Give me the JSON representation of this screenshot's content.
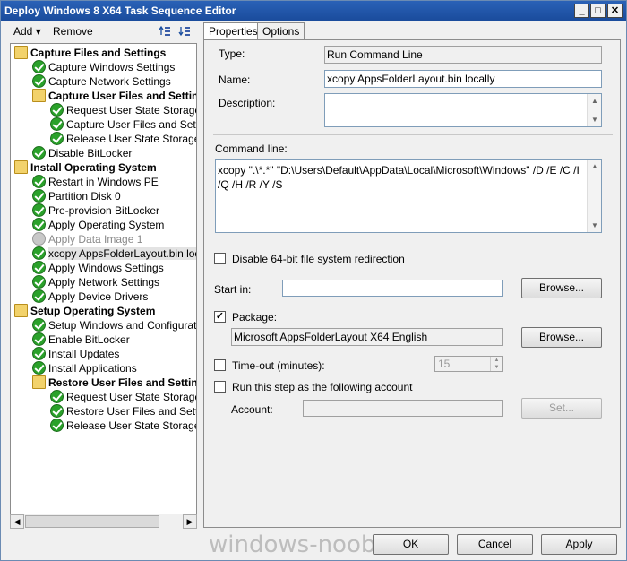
{
  "window": {
    "title": "Deploy Windows 8 X64 Task Sequence Editor",
    "minimize": "_",
    "maximize": "□",
    "close": "✕"
  },
  "toolbar": {
    "add": "Add",
    "add_arrow": "▾",
    "remove": "Remove"
  },
  "tree": [
    {
      "label": "Capture Files and Settings",
      "icon": "folder",
      "level": 0,
      "bold": true
    },
    {
      "label": "Capture Windows Settings",
      "icon": "check",
      "level": 1
    },
    {
      "label": "Capture Network Settings",
      "icon": "check",
      "level": 1
    },
    {
      "label": "Capture User Files and Settings",
      "icon": "folder",
      "level": 1,
      "bold": true
    },
    {
      "label": "Request User State Storage",
      "icon": "check",
      "level": 2
    },
    {
      "label": "Capture User Files and Settings",
      "icon": "check",
      "level": 2
    },
    {
      "label": "Release User State Storage",
      "icon": "check",
      "level": 2
    },
    {
      "label": "Disable BitLocker",
      "icon": "check",
      "level": 1
    },
    {
      "label": "Install Operating System",
      "icon": "folder",
      "level": 0,
      "bold": true
    },
    {
      "label": "Restart in Windows PE",
      "icon": "check",
      "level": 1
    },
    {
      "label": "Partition Disk 0",
      "icon": "check",
      "level": 1
    },
    {
      "label": "Pre-provision BitLocker",
      "icon": "check",
      "level": 1
    },
    {
      "label": "Apply Operating System",
      "icon": "check",
      "level": 1
    },
    {
      "label": "Apply Data Image 1",
      "icon": "disabled",
      "level": 1,
      "grey": true
    },
    {
      "label": "xcopy AppsFolderLayout.bin locally",
      "icon": "check",
      "level": 1,
      "selected": true
    },
    {
      "label": "Apply Windows Settings",
      "icon": "check",
      "level": 1
    },
    {
      "label": "Apply Network Settings",
      "icon": "check",
      "level": 1
    },
    {
      "label": "Apply Device Drivers",
      "icon": "check",
      "level": 1
    },
    {
      "label": "Setup Operating System",
      "icon": "folder",
      "level": 0,
      "bold": true
    },
    {
      "label": "Setup Windows and Configuration",
      "icon": "check",
      "level": 1
    },
    {
      "label": "Enable BitLocker",
      "icon": "check",
      "level": 1
    },
    {
      "label": "Install Updates",
      "icon": "check",
      "level": 1
    },
    {
      "label": "Install Applications",
      "icon": "check",
      "level": 1
    },
    {
      "label": "Restore User Files and Settings",
      "icon": "folder",
      "level": 1,
      "bold": true
    },
    {
      "label": "Request User State Storage",
      "icon": "check",
      "level": 2
    },
    {
      "label": "Restore User Files and Settings",
      "icon": "check",
      "level": 2
    },
    {
      "label": "Release User State Storage",
      "icon": "check",
      "level": 2
    }
  ],
  "tabs": {
    "properties": "Properties",
    "options": "Options"
  },
  "properties": {
    "type_label": "Type:",
    "type_value": "Run Command Line",
    "name_label": "Name:",
    "name_value": "xcopy AppsFolderLayout.bin locally",
    "description_label": "Description:",
    "description_value": "",
    "command_line_label": "Command line:",
    "command_line_value": "xcopy \".\\*.*\" \"D:\\Users\\Default\\AppData\\Local\\Microsoft\\Windows\" /D /E /C /I /Q /H /R /Y /S",
    "disable_64bit_label": "Disable 64-bit file system redirection",
    "disable_64bit_checked": false,
    "start_in_label": "Start in:",
    "start_in_value": "",
    "browse_label": "Browse...",
    "package_label": "Package:",
    "package_checked": true,
    "package_value": "Microsoft AppsFolderLayout X64 English",
    "package_browse_label": "Browse...",
    "timeout_label": "Time-out (minutes):",
    "timeout_checked": false,
    "timeout_value": "15",
    "run_as_label": "Run this step as the following account",
    "run_as_checked": false,
    "account_label": "Account:",
    "account_value": "",
    "set_label": "Set..."
  },
  "footer": {
    "ok": "OK",
    "cancel": "Cancel",
    "apply": "Apply",
    "watermark": "windows-noob.com"
  }
}
